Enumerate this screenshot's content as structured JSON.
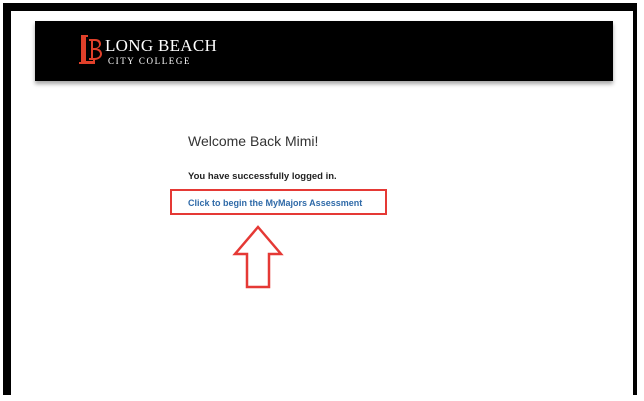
{
  "header": {
    "logo_line1": "LONG BEACH",
    "logo_line2": "CITY COLLEGE",
    "brand_color": "#e0402a",
    "background_color": "#000000"
  },
  "main": {
    "welcome_text": "Welcome Back Mimi!",
    "status_text": "You have successfully logged in.",
    "assessment_link_text": "Click to begin the MyMajors Assessment",
    "link_color": "#2f6aa8"
  },
  "annotation": {
    "highlight_color": "#e53935",
    "arrow_icon": "up-arrow-outline-icon"
  }
}
